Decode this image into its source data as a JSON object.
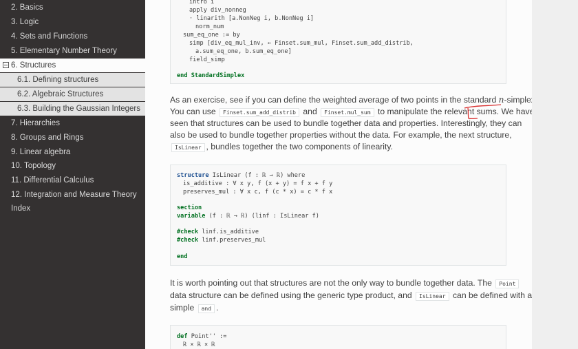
{
  "sidebar": {
    "items": [
      {
        "label": "2. Basics"
      },
      {
        "label": "3. Logic"
      },
      {
        "label": "4. Sets and Functions"
      },
      {
        "label": "5. Elementary Number Theory"
      },
      {
        "label": "6. Structures"
      },
      {
        "label": "6.1. Defining structures"
      },
      {
        "label": "6.2. Algebraic Structures"
      },
      {
        "label": "6.3. Building the Gaussian Integers"
      },
      {
        "label": "7. Hierarchies"
      },
      {
        "label": "8. Groups and Rings"
      },
      {
        "label": "9. Linear algebra"
      },
      {
        "label": "10. Topology"
      },
      {
        "label": "11. Differential Calculus"
      },
      {
        "label": "12. Integration and Measure Theory"
      },
      {
        "label": "Index"
      }
    ]
  },
  "code_block_1": {
    "lines": [
      "intro i",
      "apply div_nonneg",
      "· linarith [a.NonNeg i, b.NonNeg i]",
      "norm_num",
      "sum_eq_one := by",
      "simp [div_eq_mul_inv, ← Finset.sum_mul, Finset.sum_add_distrib,",
      "a.sum_eq_one, b.sum_eq_one]",
      "field_simp",
      "end StandardSimplex"
    ]
  },
  "paragraph_1": {
    "t1": "As an exercise, see if you can define the weighted average of two points in the standard ",
    "math": "n",
    "t2": "-simplex.",
    "t3": "You can use",
    "code1": "Finset.sum_add_distrib",
    "t4": "and",
    "code2": "Finset.mul_sum",
    "t5": "to manipulate the relevant sums. We have",
    "t6": "seen that structures can be used to bundle together data and properties. Interestingly, they can",
    "t7": "also be used to bundle together properties without the data. For example, the next structure,",
    "code3": "IsLinear",
    "t8": ", bundles together the two components of linearity."
  },
  "code_block_2": {
    "lines": [
      "structure IsLinear (f : ℝ → ℝ) where",
      "is_additive : ∀ x y, f (x + y) = f x + f y",
      "preserves_mul : ∀ x c, f (c * x) = c * f x",
      "section",
      "variable (f : ℝ → ℝ) (linf : IsLinear f)",
      "#check linf.is_additive",
      "#check linf.preserves_mul",
      "end"
    ]
  },
  "paragraph_2": {
    "t1": "It is worth pointing out that structures are not the only way to bundle together data. The",
    "code1": "Point",
    "t2": "data structure can be defined using the generic type product, and",
    "code2": "IsLinear",
    "t3": "can be defined with a",
    "t4": "simple",
    "code3": "and",
    "t5": "."
  },
  "code_block_3": {
    "lines": [
      "def Point'' :=",
      "ℝ × ℝ × ℝ"
    ]
  },
  "colors": {
    "sidebar_bg": "#343131",
    "annotation": "#d93030",
    "keyword": "#007020"
  }
}
